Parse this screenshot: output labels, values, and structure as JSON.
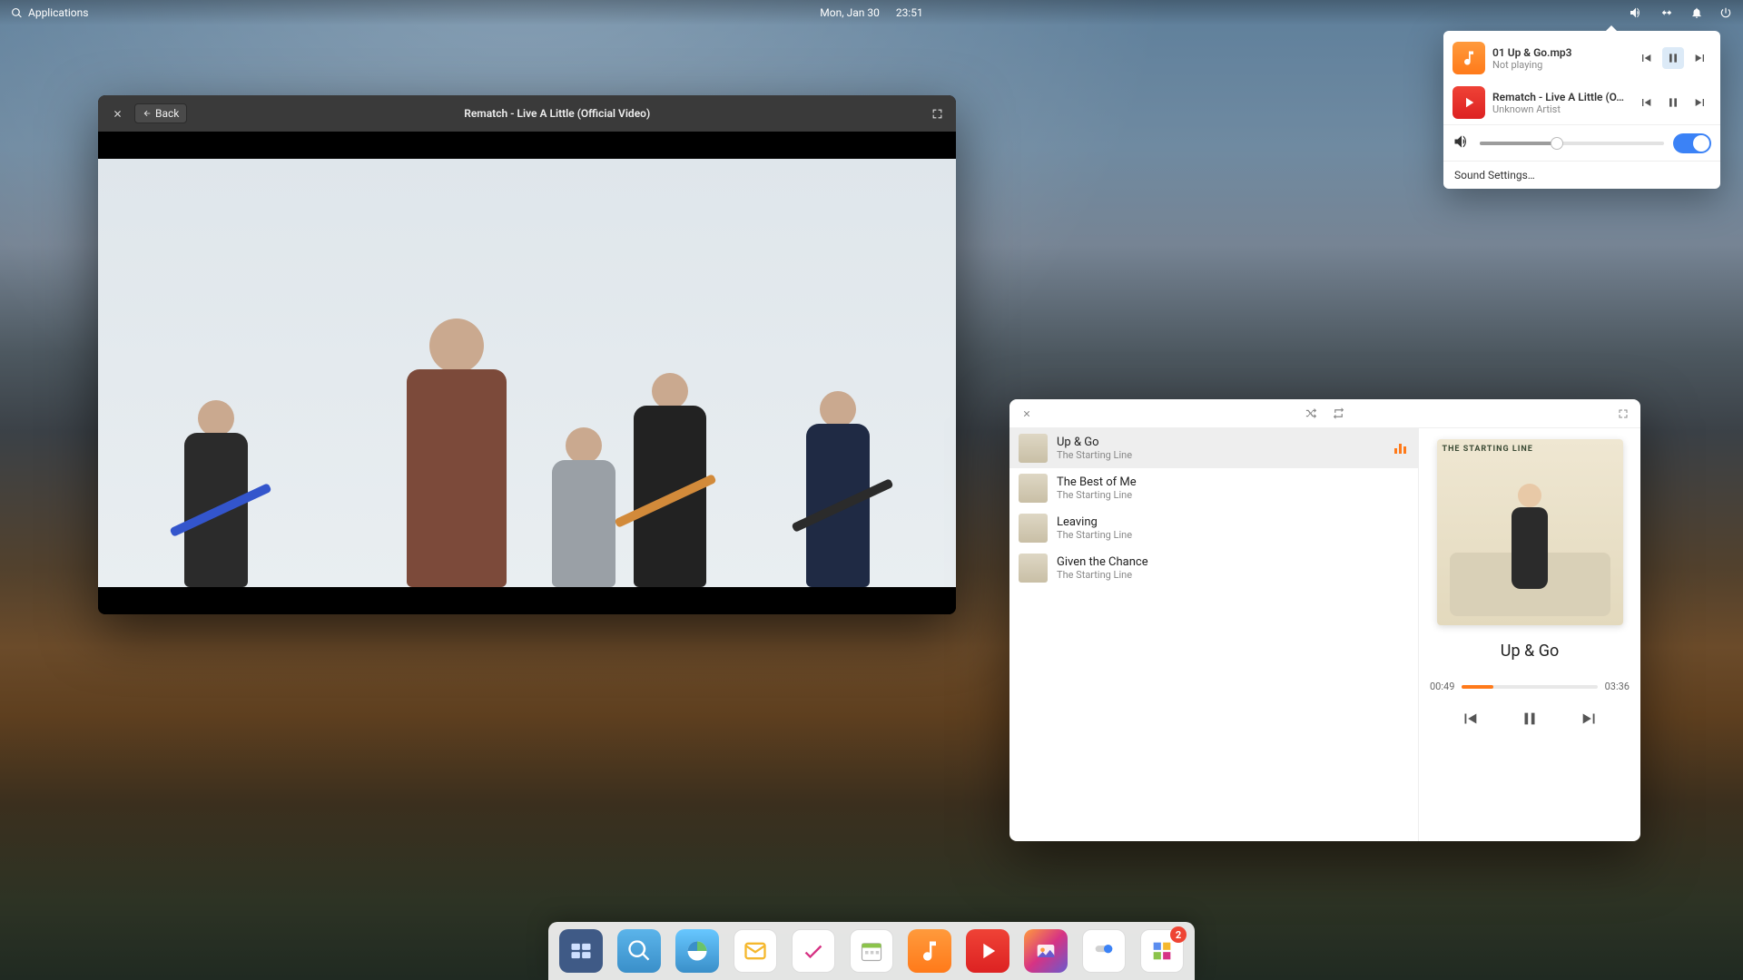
{
  "panel": {
    "applications_label": "Applications",
    "date": "Mon, Jan 30",
    "time": "23:51"
  },
  "sound_popover": {
    "items": [
      {
        "title": "01 Up & Go.mp3",
        "subtitle": "Not playing",
        "icon": "music",
        "active_btn": "pause"
      },
      {
        "title": "Rematch - Live A Little (O…",
        "subtitle": "Unknown Artist",
        "icon": "video",
        "active_btn": "none"
      }
    ],
    "volume_percent": 42,
    "output_on": true,
    "settings_label": "Sound Settings…"
  },
  "video_window": {
    "back_label": "Back",
    "title": "Rematch - Live A Little (Official Video)"
  },
  "music_window": {
    "playlist": [
      {
        "title": "Up & Go",
        "artist": "The Starting Line",
        "playing": true
      },
      {
        "title": "The Best of Me",
        "artist": "The Starting Line",
        "playing": false
      },
      {
        "title": "Leaving",
        "artist": "The Starting Line",
        "playing": false
      },
      {
        "title": "Given the Chance",
        "artist": "The Starting Line",
        "playing": false
      }
    ],
    "now_playing": {
      "cover_text": "THE STARTING LINE",
      "title": "Up & Go",
      "elapsed": "00:49",
      "total": "03:36",
      "progress_percent": 23
    }
  },
  "dock": {
    "items": [
      {
        "name": "multitasking",
        "color": "#3f5a86"
      },
      {
        "name": "search",
        "color": "#4aa3e0"
      },
      {
        "name": "web-browser",
        "color": "#4aa3e0"
      },
      {
        "name": "mail",
        "color": "#f2f2f2"
      },
      {
        "name": "tasks",
        "color": "#ffffff"
      },
      {
        "name": "calendar",
        "color": "#ffffff"
      },
      {
        "name": "music",
        "color": "#ff7a1a"
      },
      {
        "name": "videos",
        "color": "#e43"
      },
      {
        "name": "photos",
        "color": "#ffffff"
      },
      {
        "name": "settings",
        "color": "#ffffff"
      },
      {
        "name": "appcenter",
        "color": "#ffffff",
        "badge": "2"
      }
    ]
  }
}
